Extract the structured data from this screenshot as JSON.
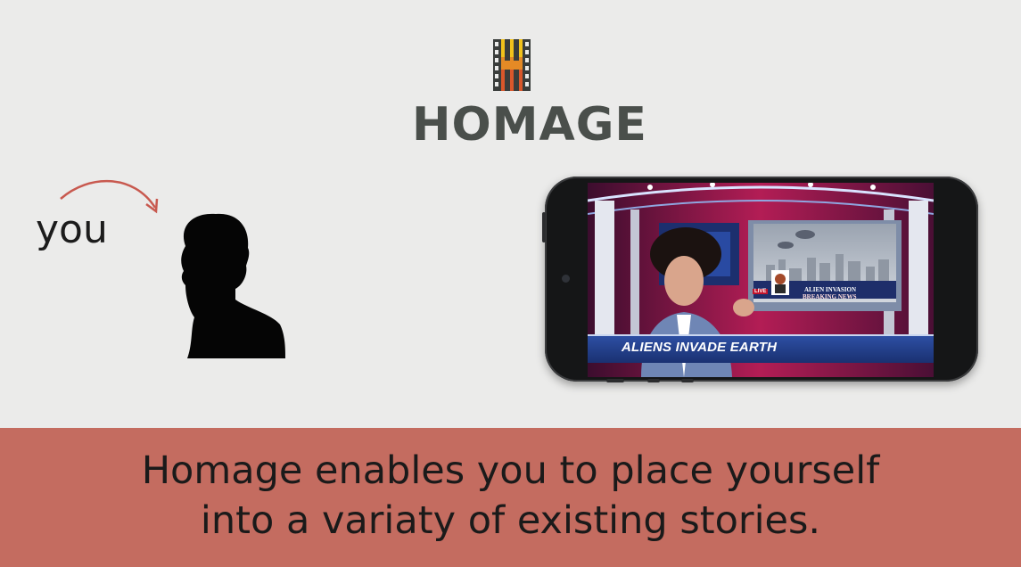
{
  "brand": {
    "name": "HOMAGE"
  },
  "scene": {
    "you_label": "you"
  },
  "phone": {
    "news": {
      "headline": "ALIENS INVADE EARTH",
      "monitor_title": "ALIEN INVASION",
      "monitor_subtitle": "BREAKING NEWS",
      "live_label": "LIVE"
    }
  },
  "caption": {
    "line1": "Homage enables you to place yourself",
    "line2": "into a variaty of existing stories."
  },
  "colors": {
    "background": "#ebebea",
    "caption_bar": "#c46c60",
    "logo_text": "#4a4f4b",
    "arrow": "#c8594f",
    "news_bar": "#2d4fa3"
  }
}
